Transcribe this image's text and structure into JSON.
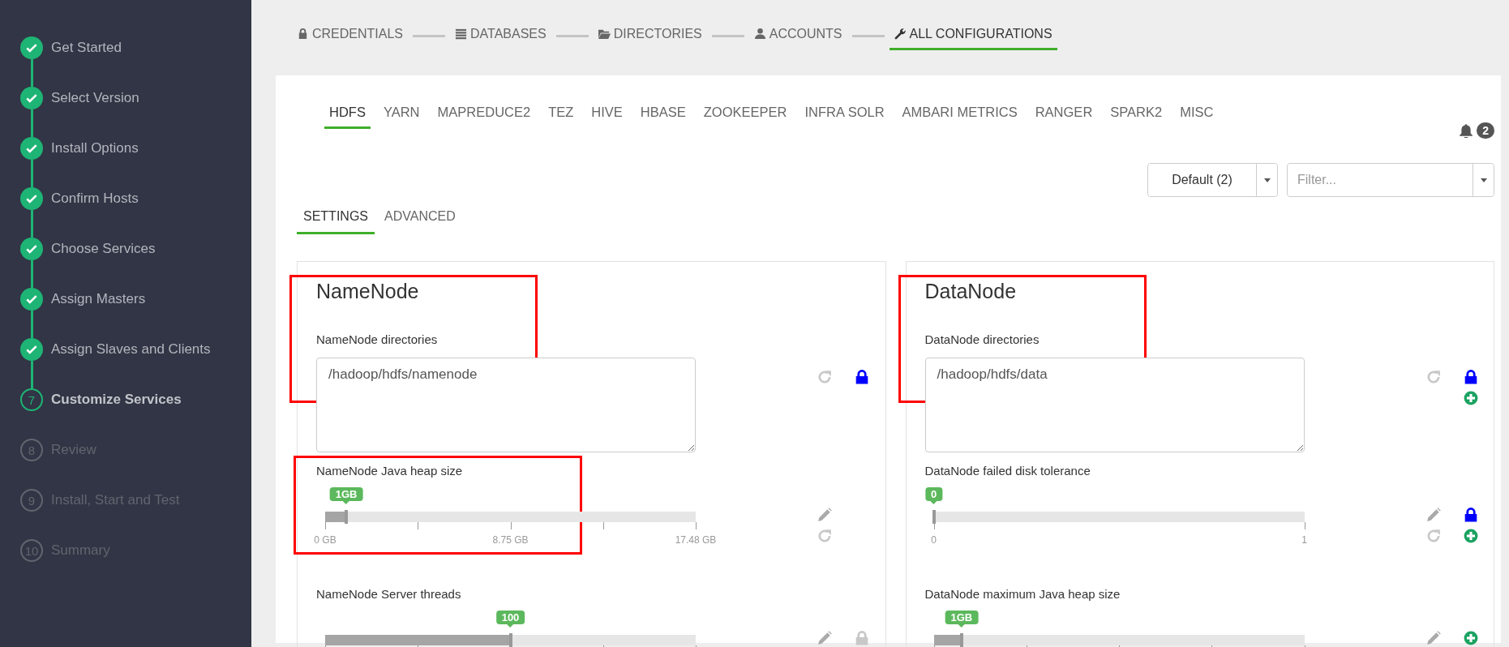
{
  "sidebar": {
    "steps": [
      {
        "label": "Get Started",
        "kind": "done"
      },
      {
        "label": "Select Version",
        "kind": "done"
      },
      {
        "label": "Install Options",
        "kind": "done"
      },
      {
        "label": "Confirm Hosts",
        "kind": "done"
      },
      {
        "label": "Choose Services",
        "kind": "done"
      },
      {
        "label": "Assign Masters",
        "kind": "done"
      },
      {
        "label": "Assign Slaves and Clients",
        "kind": "done"
      },
      {
        "label": "Customize Services",
        "kind": "current",
        "number": "7"
      },
      {
        "label": "Review",
        "kind": "pending",
        "number": "8"
      },
      {
        "label": "Install, Start and Test",
        "kind": "pending",
        "number": "9"
      },
      {
        "label": "Summary",
        "kind": "pending",
        "number": "10"
      }
    ]
  },
  "wizard_tabs": [
    {
      "label": "CREDENTIALS",
      "kind": "lock",
      "selected": false
    },
    {
      "label": "DATABASES",
      "kind": "list",
      "selected": false
    },
    {
      "label": "DIRECTORIES",
      "kind": "folder",
      "selected": false
    },
    {
      "label": "ACCOUNTS",
      "kind": "user",
      "selected": false
    },
    {
      "label": "ALL CONFIGURATIONS",
      "kind": "wrench",
      "selected": true
    }
  ],
  "service_tabs": [
    {
      "label": "HDFS",
      "selected": true
    },
    {
      "label": "YARN",
      "selected": false
    },
    {
      "label": "MAPREDUCE2",
      "selected": false
    },
    {
      "label": "TEZ",
      "selected": false
    },
    {
      "label": "HIVE",
      "selected": false
    },
    {
      "label": "HBASE",
      "selected": false
    },
    {
      "label": "ZOOKEEPER",
      "selected": false
    },
    {
      "label": "INFRA SOLR",
      "selected": false
    },
    {
      "label": "AMBARI METRICS",
      "selected": false
    },
    {
      "label": "RANGER",
      "selected": false
    },
    {
      "label": "SPARK2",
      "selected": false
    },
    {
      "label": "MISC",
      "selected": false
    }
  ],
  "notifications": {
    "count": "2"
  },
  "config_group": {
    "label": "Default (2)"
  },
  "filter": {
    "placeholder": "Filter..."
  },
  "section_tabs": [
    {
      "label": "SETTINGS",
      "selected": true
    },
    {
      "label": "ADVANCED",
      "selected": false
    }
  ],
  "cards": [
    {
      "title": "NameNode",
      "highlighted": true,
      "fields": [
        {
          "kind": "text",
          "label": "NameNode directories",
          "value": "/hadoop/hdfs/namenode",
          "actions": [
            {
              "kind": "undo",
              "active": false
            },
            {
              "kind": "lock",
              "active": true
            }
          ]
        },
        {
          "kind": "slider",
          "label": "NameNode Java heap size",
          "value": "1GB",
          "level": 0.057,
          "tick_labels": [
            "0 GB",
            "8.75 GB",
            "17.48 GB"
          ],
          "highlighted": true,
          "actions": [
            {
              "kind": "edit",
              "active": false
            },
            {
              "kind": "undo",
              "active": false
            }
          ]
        },
        {
          "kind": "slider",
          "label": "NameNode Server threads",
          "value": "100",
          "level": 0.5,
          "actions": [
            {
              "kind": "edit",
              "active": false
            },
            {
              "kind": "lock",
              "active": false
            }
          ]
        }
      ]
    },
    {
      "title": "DataNode",
      "highlighted": true,
      "fields": [
        {
          "kind": "text",
          "label": "DataNode directories",
          "value": "/hadoop/hdfs/data",
          "actions": [
            {
              "kind": "undo",
              "active": false
            },
            {
              "kind": "lock",
              "active": true
            },
            {
              "kind": "add",
              "active": true
            }
          ]
        },
        {
          "kind": "slider",
          "label": "DataNode failed disk tolerance",
          "value": "0",
          "level": 0,
          "tick_labels": [
            "0",
            "1"
          ],
          "actions": [
            {
              "kind": "edit",
              "active": false
            },
            {
              "kind": "undo",
              "active": false
            },
            {
              "kind": "lock",
              "active": true
            },
            {
              "kind": "add",
              "active": true
            }
          ]
        },
        {
          "kind": "slider",
          "label": "DataNode maximum Java heap size",
          "value": "1GB",
          "level": 0.075,
          "actions": [
            {
              "kind": "edit",
              "active": false
            },
            {
              "kind": "add",
              "active": true
            }
          ]
        }
      ]
    }
  ]
}
